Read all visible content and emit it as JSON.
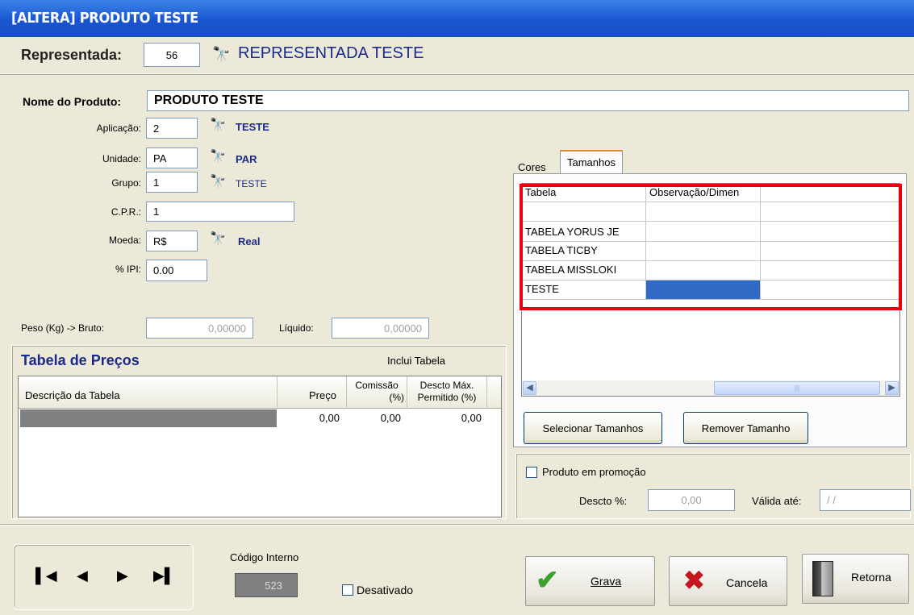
{
  "window": {
    "title": "[ALTERA] PRODUTO TESTE"
  },
  "representada": {
    "label": "Representada:",
    "code": "56",
    "name": "REPRESENTADA TESTE"
  },
  "produto": {
    "nome_label": "Nome do Produto:",
    "nome_value": "PRODUTO TESTE",
    "aplicacao_label": "Aplicação:",
    "aplicacao_value": "2",
    "aplicacao_desc": "TESTE",
    "unidade_label": "Unidade:",
    "unidade_value": "PA",
    "unidade_desc": "PAR",
    "grupo_label": "Grupo:",
    "grupo_value": "1",
    "grupo_desc": "TESTE",
    "cpr_label": "C.P.R.:",
    "cpr_value": "1",
    "moeda_label": "Moeda:",
    "moeda_value": "R$",
    "moeda_desc": "Real",
    "ipi_label": "% IPI:",
    "ipi_value": "0.00",
    "peso_label": "Peso (Kg) -> Bruto:",
    "peso_bruto": "0,00000",
    "liquido_label": "Líquido:",
    "peso_liquido": "0,00000"
  },
  "precos": {
    "title": "Tabela de Preços",
    "inclui_label": "Inclui Tabela",
    "headers": {
      "descricao": "Descrição da Tabela",
      "preco": "Preço",
      "comissao_1": "Comissão",
      "comissao_2": "(%)",
      "descto_1": "Descto Máx.",
      "descto_2": "Permitido (%)"
    },
    "row": {
      "descricao": "",
      "preco": "0,00",
      "comissao": "0,00",
      "descto": "0,00"
    }
  },
  "tabs": [
    {
      "label": "Cores"
    },
    {
      "label": "Tamanhos"
    }
  ],
  "tamanhos": {
    "headers": [
      "Tabela",
      "Observação/Dimen"
    ],
    "rows": [
      {
        "tabela": "",
        "obs": ""
      },
      {
        "tabela": "TABELA YORUS JE",
        "obs": ""
      },
      {
        "tabela": "TABELA TICBY",
        "obs": ""
      },
      {
        "tabela": "TABELA MISSLOKI",
        "obs": ""
      },
      {
        "tabela": "TESTE",
        "obs": ""
      }
    ],
    "selecionar_label": "Selecionar Tamanhos",
    "remover_label": "Remover Tamanho"
  },
  "promocao": {
    "checkbox_label": "Produto em promoção",
    "descto_label": "Descto %:",
    "descto_value": "0,00",
    "valida_label": "Válida até:",
    "valida_value": "/ /"
  },
  "footer": {
    "codigo_label": "Código Interno",
    "codigo_value": "523",
    "desativado_label": "Desativado",
    "grava_label": "Grava",
    "cancela_label": "Cancela",
    "retorna_label": "Retorna"
  },
  "colors": {
    "title_bar": "#1854d1",
    "highlight_red": "#e8000b",
    "selected_cell": "#316ac5",
    "grava_check": "#3ea12d",
    "cancela_x": "#c4161c"
  }
}
